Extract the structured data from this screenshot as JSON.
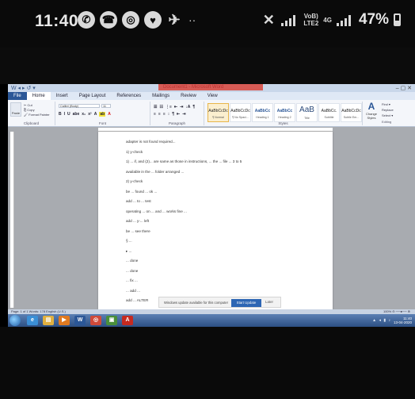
{
  "phone_status": {
    "time": "11:40",
    "left_icons": [
      {
        "name": "whatsapp-icon",
        "glyph": "✆"
      },
      {
        "name": "phone-icon",
        "glyph": "☎"
      },
      {
        "name": "chrome-icon",
        "glyph": "◎"
      },
      {
        "name": "heart-icon",
        "glyph": "♥"
      },
      {
        "name": "bike-icon",
        "glyph": "✈"
      }
    ],
    "dots": "··",
    "network_top": "VoB)",
    "network_bottom": "LTE2",
    "network_type": "4G",
    "battery_percent": "47%"
  },
  "word": {
    "qat": "W ◂ ▸ ↺ ▾",
    "window_title": "Document1 - Microsoft Word",
    "window_buttons": "–  ▢  ✕",
    "tabs": [
      "File",
      "Home",
      "Insert",
      "Page Layout",
      "References",
      "Mailings",
      "Review",
      "View"
    ],
    "active_tab": "Home",
    "clipboard": {
      "paste": "Paste",
      "cut": "✂ Cut",
      "copy": "⎘ Copy",
      "format_painter": "🖌 Format Painter",
      "label": "Clipboard"
    },
    "font": {
      "name": "Calibri (Body)",
      "size": "11",
      "label": "Font",
      "formatting": [
        "B",
        "I",
        "U",
        "abe",
        "x₂",
        "x²",
        "A",
        "ab",
        "A"
      ]
    },
    "paragraph": {
      "label": "Paragraph",
      "controls": [
        "≡",
        "≡",
        "≡",
        "↕",
        "¶",
        "⇤",
        "⇥"
      ]
    },
    "styles": {
      "label": "Styles",
      "items": [
        {
          "sample": "AaBbCcDc",
          "name": "¶ Normal",
          "selected": true
        },
        {
          "sample": "AaBbCcDc",
          "name": "¶ No Spaci...",
          "selected": false
        },
        {
          "sample": "AaBbCc",
          "name": "Heading 1",
          "selected": false
        },
        {
          "sample": "AaBbCc",
          "name": "Heading 2",
          "selected": false
        },
        {
          "sample": "AaB",
          "name": "Title",
          "selected": false
        },
        {
          "sample": "AaBbCc.",
          "name": "Subtitle",
          "selected": false
        },
        {
          "sample": "AaBbCcDc",
          "name": "Subtle Em...",
          "selected": false
        }
      ]
    },
    "change_styles": {
      "glyph": "A",
      "label": "Change Styles"
    },
    "editing": {
      "label": "Editing",
      "find": "Find ▾",
      "replace": "Replace",
      "select": "Select ▾"
    },
    "document_lines": [
      "adapter is not found required...",
      "1) y-check",
      "1)  ... if, and (2)... are same as those in instructions, ... the ... file ... 3 to 5",
      "available in the ... folder arranged ...",
      "2) y-check",
      "be ... found ... ok ...",
      "add ... to ... test",
      "operating ... on ... and ... works fine ...",
      "add ... y-... left",
      "be ... see there",
      "§ ...",
      "▸ ...",
      "... done",
      "... done",
      "... fix ...",
      "... add ... ",
      "add ... ALTER"
    ],
    "notification": {
      "text": "Windows update available for this computer",
      "button": "Start Update",
      "close": "Later"
    },
    "word_status": {
      "left": "Page: 1 of 1   Words: 178   English (U.S.)",
      "zoom": "100% ⊖ ──●── ⊕"
    },
    "taskbar_apps": [
      {
        "name": "ie-icon",
        "glyph": "e",
        "color": "#3b8fd6"
      },
      {
        "name": "folder-icon",
        "glyph": "▤",
        "color": "#e0b040"
      },
      {
        "name": "media-player-icon",
        "glyph": "▶",
        "color": "#e07a20"
      },
      {
        "name": "word-icon",
        "glyph": "W",
        "color": "#2b5797"
      },
      {
        "name": "chrome-taskbar-icon",
        "glyph": "◎",
        "color": "#d04a3a"
      },
      {
        "name": "app-icon",
        "glyph": "▣",
        "color": "#4a8f3a"
      },
      {
        "name": "acrobat-icon",
        "glyph": "A",
        "color": "#c52a20"
      }
    ],
    "tray_icons": "▲ ◂ ▮ ♪",
    "tray_time": "11:40",
    "tray_date": "13-04-2020"
  }
}
